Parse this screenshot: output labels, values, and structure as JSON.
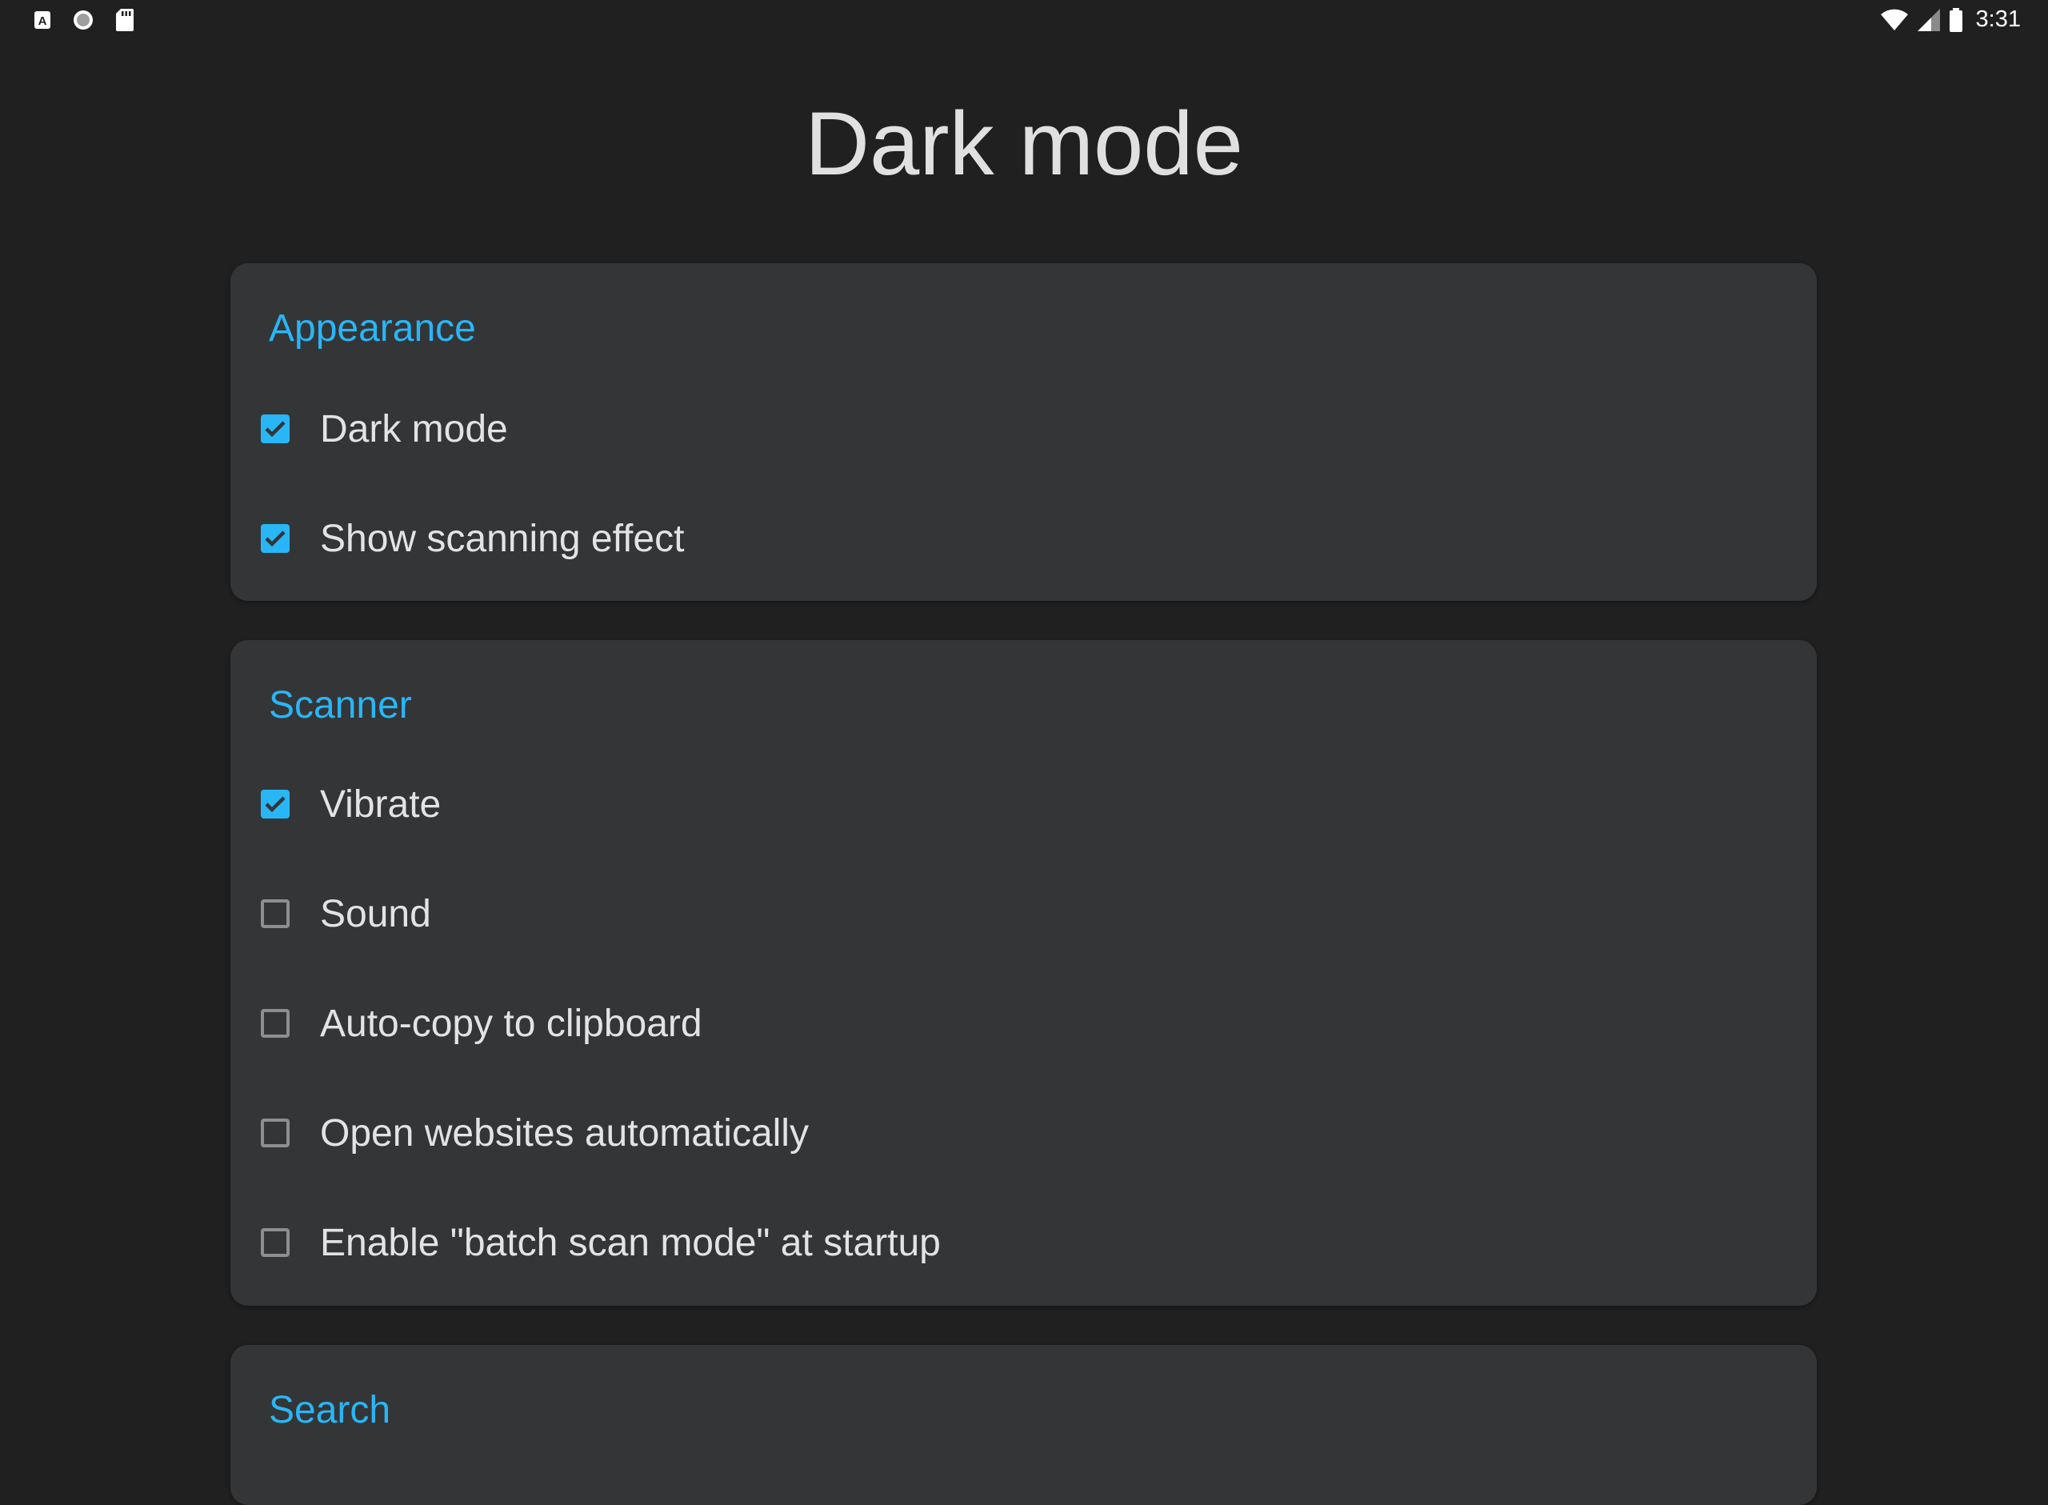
{
  "status_bar": {
    "left_icons": [
      "a-notification-icon",
      "circle-notification-icon",
      "sd-card-icon"
    ],
    "right_icons": [
      "wifi-icon",
      "cell-signal-icon",
      "battery-icon"
    ],
    "time": "3:31"
  },
  "page": {
    "title": "Dark mode"
  },
  "colors": {
    "background": "#202020",
    "card": "#343537",
    "accent": "#29b6f6",
    "text": "#e3e3e3"
  },
  "sections": {
    "appearance": {
      "title": "Appearance",
      "items": [
        {
          "label": "Dark mode",
          "checked": true
        },
        {
          "label": "Show scanning effect",
          "checked": true
        }
      ]
    },
    "scanner": {
      "title": "Scanner",
      "items": [
        {
          "label": "Vibrate",
          "checked": true
        },
        {
          "label": "Sound",
          "checked": false
        },
        {
          "label": "Auto-copy to clipboard",
          "checked": false
        },
        {
          "label": "Open websites automatically",
          "checked": false
        },
        {
          "label": "Enable \"batch scan mode\" at startup",
          "checked": false
        }
      ]
    },
    "search": {
      "title": "Search"
    }
  }
}
